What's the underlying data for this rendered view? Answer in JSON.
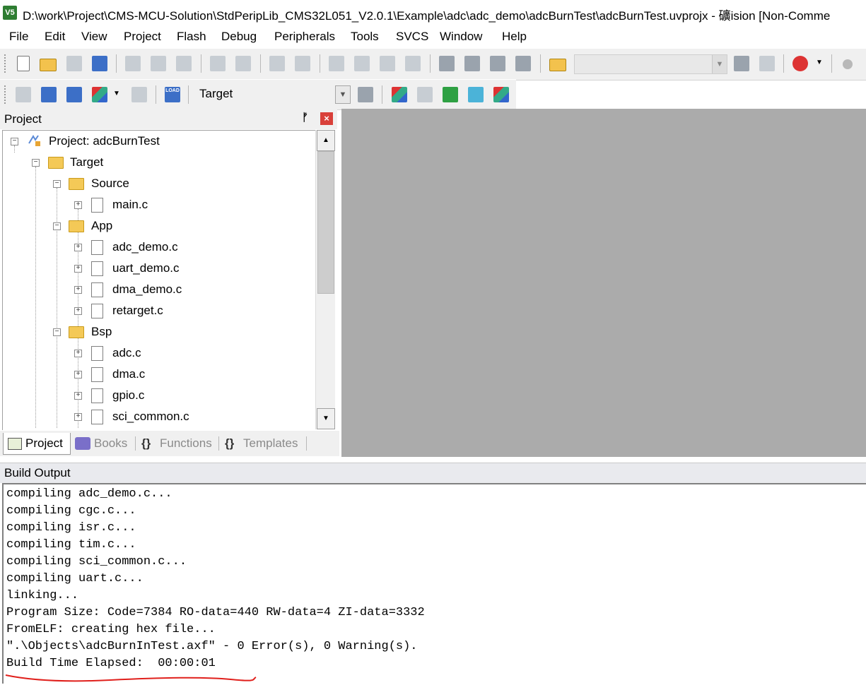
{
  "window": {
    "logo_text": "V5",
    "title": "D:\\work\\Project\\CMS-MCU-Solution\\StdPeripLib_CMS32L051_V2.0.1\\Example\\adc\\adc_demo\\adcBurnTest\\adcBurnTest.uvprojx - 礦ision  [Non-Comme"
  },
  "menu": [
    "File",
    "Edit",
    "View",
    "Project",
    "Flash",
    "Debug",
    "Peripherals",
    "Tools",
    "SVCS",
    "Window",
    "Help"
  ],
  "toolbar": {
    "target_selected": "Target",
    "load_label": "LOAD"
  },
  "project_panel": {
    "title": "Project",
    "pin_glyph": "ᚠ",
    "close_glyph": "×",
    "tree": {
      "root": "Project: adcBurnTest",
      "target": "Target",
      "groups": [
        {
          "name": "Source",
          "files": [
            "main.c"
          ]
        },
        {
          "name": "App",
          "files": [
            "adc_demo.c",
            "uart_demo.c",
            "dma_demo.c",
            "retarget.c"
          ]
        },
        {
          "name": "Bsp",
          "files": [
            "adc.c",
            "dma.c",
            "gpio.c",
            "sci_common.c"
          ]
        }
      ]
    },
    "tabs": [
      "Project",
      "Books",
      "Functions",
      "Templates"
    ],
    "tab_icons": [
      "",
      "",
      "{}",
      "{}"
    ]
  },
  "build_output": {
    "title": "Build Output",
    "lines": [
      "compiling adc_demo.c...",
      "compiling cgc.c...",
      "compiling isr.c...",
      "compiling tim.c...",
      "compiling sci_common.c...",
      "compiling uart.c...",
      "linking...",
      "Program Size: Code=7384 RO-data=440 RW-data=4 ZI-data=3332",
      "FromELF: creating hex file...",
      "\".\\Objects\\adcBurnInTest.axf\" - 0 Error(s), 0 Warning(s).",
      "Build Time Elapsed:  00:00:01"
    ]
  },
  "colors": {
    "annotation_underline": "#e0201c",
    "editor_background": "#ababab",
    "close_button": "#d9403a"
  }
}
